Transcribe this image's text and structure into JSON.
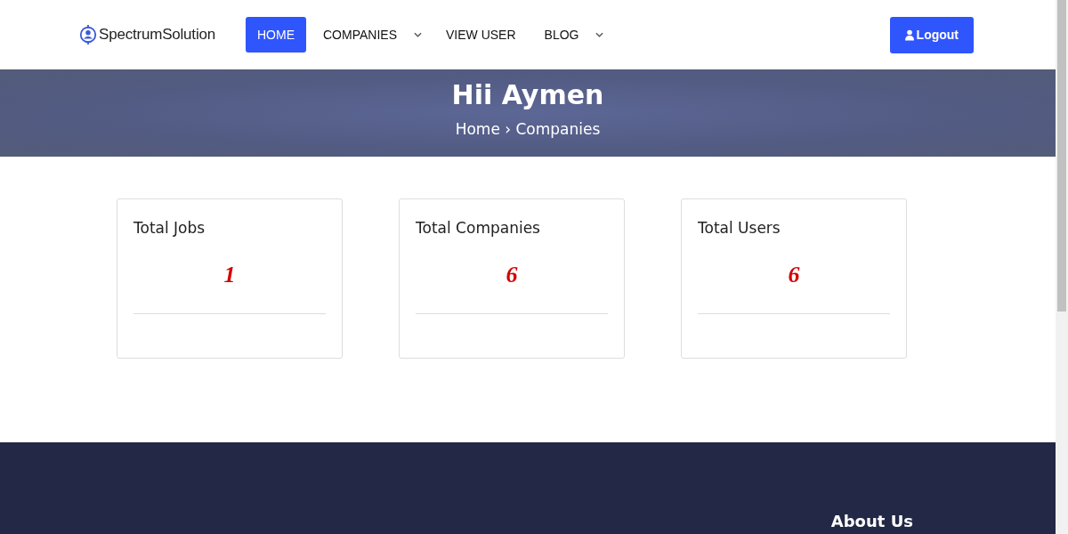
{
  "logo": {
    "text": "SpectrumSolution"
  },
  "nav": [
    {
      "label": "HOME",
      "selected": true,
      "dropdown": false
    },
    {
      "label": "COMPANIES",
      "selected": false,
      "dropdown": true
    },
    {
      "label": "VIEW USER",
      "selected": false,
      "dropdown": false
    },
    {
      "label": "BLOG",
      "selected": false,
      "dropdown": true
    }
  ],
  "logout_button": "Logout",
  "banner": {
    "title": "Hii Aymen",
    "breadcrumb": "Home › Companies"
  },
  "stats": [
    {
      "title": "Total Jobs",
      "value": "1"
    },
    {
      "title": "Total Companies",
      "value": "6"
    },
    {
      "title": "Total Users",
      "value": "6"
    }
  ],
  "footer": {
    "heading": "About Us"
  }
}
